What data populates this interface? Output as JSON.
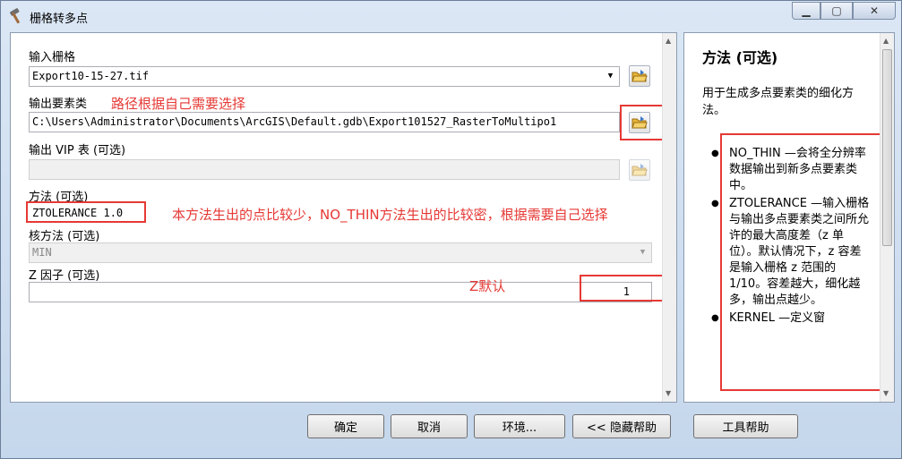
{
  "window": {
    "title": "栅格转多点",
    "controls": {
      "minimize": "▁",
      "maximize": "▢",
      "close": "✕"
    }
  },
  "params": {
    "input_raster_label": "输入栅格",
    "input_raster_value": "Export10-15-27.tif",
    "output_features_label": "输出要素类",
    "output_features_value": "C:\\Users\\Administrator\\Documents\\ArcGIS\\Default.gdb\\Export101527_RasterToMultipo1",
    "output_vip_label": "输出 VIP 表 (可选)",
    "output_vip_value": "",
    "method_label": "方法 (可选)",
    "method_value": "ZTOLERANCE 1.0",
    "kernel_label": "核方法 (可选)",
    "kernel_value": "MIN",
    "zfactor_label": "Z 因子 (可选)",
    "zfactor_value": "1"
  },
  "annotations": {
    "path_note": "路径根据自己需要选择",
    "method_note": "本方法生出的点比较少，NO_THIN方法生出的比较密，根据需要自己选择",
    "z_note": "Z默认"
  },
  "help": {
    "title": "方法 (可选)",
    "description": "用于生成多点要素类的细化方法。",
    "items": [
      "NO_THIN —会将全分辨率数据输出到新多点要素类中。",
      "ZTOLERANCE —输入栅格与输出多点要素类之间所允许的最大高度差（z 单位）。默认情况下，z 容差是输入栅格 z 范围的 1/10。容差越大，细化越多，输出点越少。",
      "KERNEL —定义窗"
    ]
  },
  "buttons": {
    "ok": "确定",
    "cancel": "取消",
    "environments": "环境...",
    "hide_help": "<< 隐藏帮助",
    "tool_help": "工具帮助"
  },
  "colors": {
    "annotation": "#e53935"
  }
}
